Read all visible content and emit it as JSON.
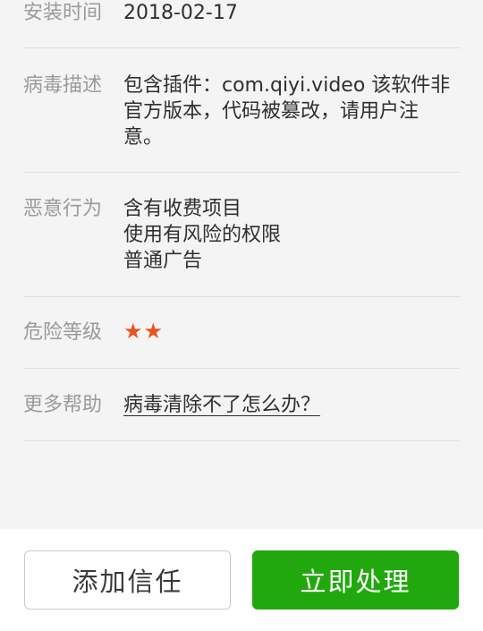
{
  "details": {
    "install_time": {
      "label": "安装时间",
      "value": "2018-02-17"
    },
    "virus_description": {
      "label": "病毒描述",
      "lines": [
        "包含插件：com.qiyi.video 该软件非",
        "官方版本，代码被篡改，请用户注",
        "意。"
      ]
    },
    "malicious_behavior": {
      "label": "恶意行为",
      "lines": [
        "含有收费项目",
        "使用有风险的权限",
        "普通广告"
      ]
    },
    "risk_level": {
      "label": "危险等级",
      "stars": "★★",
      "star_count": 2,
      "star_color": "#e8541d"
    },
    "more_help": {
      "label": "更多帮助",
      "link_text": "病毒清除不了怎么办？"
    }
  },
  "actions": {
    "add_trust": "添加信任",
    "process_now": "立即处理",
    "process_color": "#22a80f"
  }
}
